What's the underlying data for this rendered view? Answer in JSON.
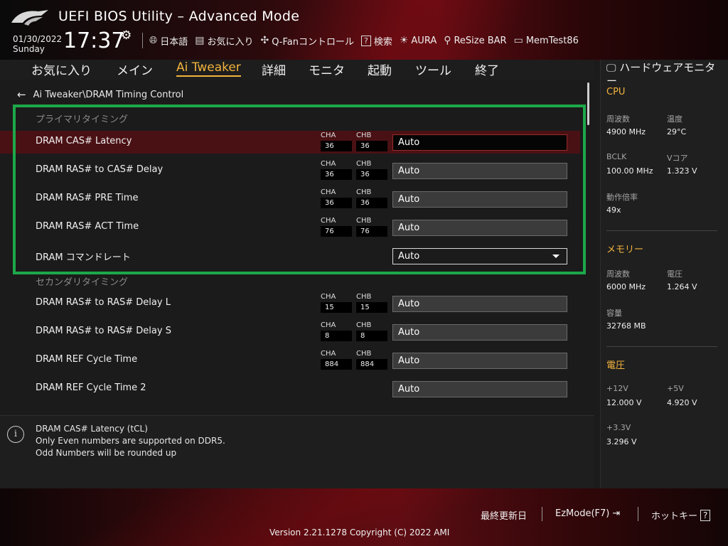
{
  "header": {
    "title": "UEFI BIOS Utility – Advanced Mode",
    "date": "01/30/2022",
    "day": "Sunday",
    "time": "17:37",
    "toolbar": [
      {
        "label": "日本語",
        "icon": "globe-icon"
      },
      {
        "label": "お気に入り",
        "icon": "favorites-icon"
      },
      {
        "label": "Q-Fanコントロール",
        "icon": "fan-icon"
      },
      {
        "label": "検索",
        "icon": "search-icon"
      },
      {
        "label": "AURA",
        "icon": "aura-icon"
      },
      {
        "label": "ReSize BAR",
        "icon": "resize-bar-icon"
      },
      {
        "label": "MemTest86",
        "icon": "memtest-icon"
      }
    ]
  },
  "tabs": [
    "お気に入り",
    "メイン",
    "Ai Tweaker",
    "詳細",
    "モニタ",
    "起動",
    "ツール",
    "終了"
  ],
  "active_tab": "Ai Tweaker",
  "breadcrumb": "Ai Tweaker\\DRAM Timing Control",
  "primary_section": "プライマリタイミング",
  "secondary_section": "セカンダリタイミング",
  "channel_labels": {
    "a": "CHA",
    "b": "CHB"
  },
  "rows": [
    {
      "label": "DRAM CAS# Latency",
      "cha": "36",
      "chb": "36",
      "value": "Auto"
    },
    {
      "label": "DRAM RAS# to CAS# Delay",
      "cha": "36",
      "chb": "36",
      "value": "Auto"
    },
    {
      "label": "DRAM RAS# PRE Time",
      "cha": "36",
      "chb": "36",
      "value": "Auto"
    },
    {
      "label": "DRAM RAS# ACT Time",
      "cha": "76",
      "chb": "76",
      "value": "Auto"
    },
    {
      "label": "DRAM コマンドレート",
      "value": "Auto"
    },
    {
      "label": "DRAM RAS# to RAS# Delay L",
      "cha": "15",
      "chb": "15",
      "value": "Auto"
    },
    {
      "label": "DRAM RAS# to RAS# Delay S",
      "cha": "8",
      "chb": "8",
      "value": "Auto"
    },
    {
      "label": "DRAM REF Cycle Time",
      "cha": "884",
      "chb": "884",
      "value": "Auto"
    },
    {
      "label": "DRAM REF Cycle Time 2",
      "value": "Auto"
    }
  ],
  "help": [
    "DRAM CAS# Latency (tCL)",
    "Only Even numbers are supported on DDR5.",
    "Odd Numbers will be rounded up"
  ],
  "monitor": {
    "title": "ハードウェアモニター",
    "cpu": {
      "heading": "CPU",
      "freq_label": "周波数",
      "freq": "4900 MHz",
      "temp_label": "温度",
      "temp": "29°C",
      "bclk_label": "BCLK",
      "bclk": "100.00 MHz",
      "vcore_label": "Vコア",
      "vcore": "1.323 V",
      "ratio_label": "動作倍率",
      "ratio": "49x"
    },
    "memory": {
      "heading": "メモリー",
      "freq_label": "周波数",
      "freq": "6000 MHz",
      "volt_label": "電圧",
      "volt": "1.264 V",
      "cap_label": "容量",
      "cap": "32768 MB"
    },
    "voltage": {
      "heading": "電圧",
      "v12_label": "+12V",
      "v12": "12.000 V",
      "v5_label": "+5V",
      "v5": "4.920 V",
      "v33_label": "+3.3V",
      "v33": "3.296 V"
    }
  },
  "footer": {
    "last_modified": "最終更新日",
    "ezmode": "EzMode(F7)",
    "hotkey": "ホットキー",
    "hotkey_box": "?",
    "version": "Version 2.21.1278 Copyright (C) 2022 AMI"
  },
  "colors": {
    "accent": "#f2b33d",
    "highlight_box": "#1da84a",
    "selected_row": "#4a1114"
  }
}
